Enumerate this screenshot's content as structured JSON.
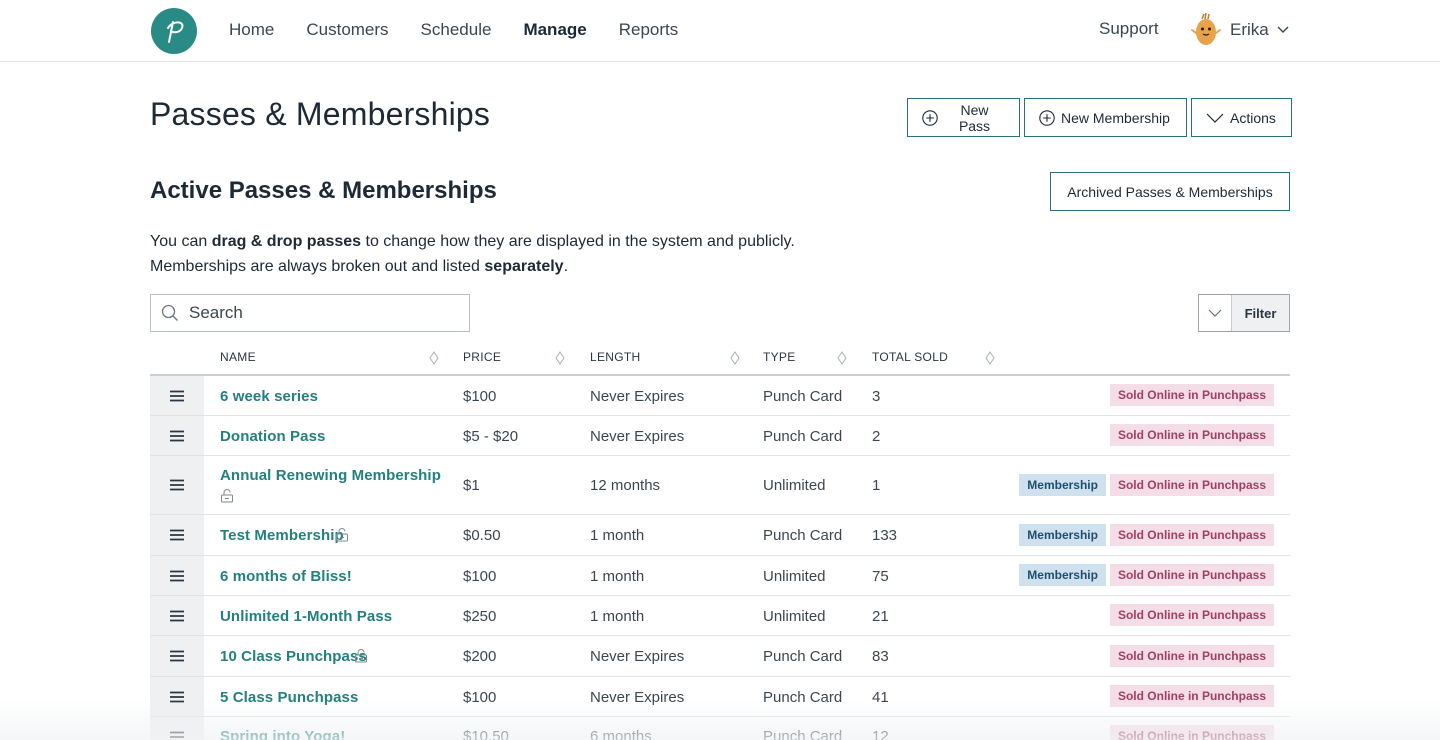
{
  "nav": {
    "items": [
      "Home",
      "Customers",
      "Schedule",
      "Manage",
      "Reports"
    ],
    "active": "Manage",
    "support": "Support",
    "user_name": "Erika"
  },
  "page": {
    "title": "Passes & Memberships",
    "buttons": {
      "new_pass": "New Pass",
      "new_membership": "New Membership",
      "actions": "Actions"
    },
    "section_title": "Active Passes & Memberships",
    "archived_button": "Archived Passes & Memberships",
    "intro": {
      "l1a": "You can ",
      "l1b": "drag & drop passes",
      "l1c": " to change how they are displayed in the system and publicly.",
      "l2a": "Memberships are always broken out and listed ",
      "l2b": "separately",
      "l2c": "."
    },
    "search_placeholder": "Search",
    "filter_label": "Filter"
  },
  "table": {
    "headers": {
      "name": "NAME",
      "price": "PRICE",
      "length": "LENGTH",
      "type": "TYPE",
      "sold": "TOTAL SOLD"
    },
    "badge_membership": "Membership",
    "badge_sold": "Sold Online in Punchpass",
    "rows": [
      {
        "name": "6 week series",
        "price": "$100",
        "length": "Never Expires",
        "type": "Punch Card",
        "sold": "3",
        "membership": false
      },
      {
        "name": "Donation Pass",
        "price": "$5 - $20",
        "length": "Never Expires",
        "type": "Punch Card",
        "sold": "2",
        "membership": false
      },
      {
        "name": "Annual Renewing Membership",
        "price": "$1",
        "length": "12 months",
        "type": "Unlimited",
        "sold": "1",
        "membership": true
      },
      {
        "name": "Test Membership",
        "price": "$0.50",
        "length": "1 month",
        "type": "Punch Card",
        "sold": "133",
        "membership": true
      },
      {
        "name": "6 months of Bliss!",
        "price": "$100",
        "length": "1 month",
        "type": "Unlimited",
        "sold": "75",
        "membership": true
      },
      {
        "name": "Unlimited 1-Month Pass",
        "price": "$250",
        "length": "1 month",
        "type": "Unlimited",
        "sold": "21",
        "membership": false
      },
      {
        "name": "10 Class Punchpass",
        "price": "$200",
        "length": "Never Expires",
        "type": "Punch Card",
        "sold": "83",
        "membership": false
      },
      {
        "name": "5 Class Punchpass",
        "price": "$100",
        "length": "Never Expires",
        "type": "Punch Card",
        "sold": "41",
        "membership": false
      },
      {
        "name": "Spring into Yoga!",
        "price": "$10.50",
        "length": "6 months",
        "type": "Punch Card",
        "sold": "12",
        "membership": false
      }
    ]
  },
  "colors": {
    "accent": "#2a8a85",
    "link": "#22807e",
    "sold_badge_bg": "#f5dde7",
    "membership_badge_bg": "#cfe1ee"
  }
}
